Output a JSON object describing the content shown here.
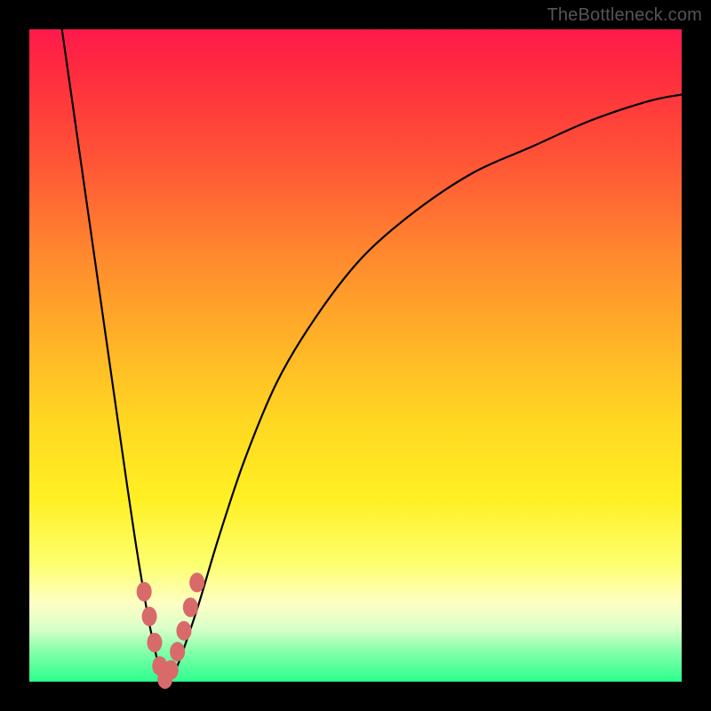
{
  "watermark": "TheBottleneck.com",
  "chart_data": {
    "type": "line",
    "title": "",
    "xlabel": "",
    "ylabel": "",
    "xlim": [
      0,
      100
    ],
    "ylim": [
      0,
      100
    ],
    "grid": false,
    "series": [
      {
        "name": "bottleneck-curve",
        "x": [
          5,
          7,
          9,
          11,
          13,
          15,
          16.5,
          18,
          19,
          20,
          21,
          22.5,
          24,
          26,
          29,
          33,
          38,
          44,
          51,
          59,
          68,
          77,
          86,
          95,
          100
        ],
        "y": [
          100,
          86,
          72,
          58,
          44,
          30,
          20,
          11,
          6,
          2,
          0,
          2,
          6,
          12,
          22,
          34,
          46,
          56,
          65,
          72,
          78,
          82,
          86,
          89,
          90
        ]
      }
    ],
    "markers": {
      "name": "highlight-dots",
      "color": "#d86a6a",
      "x": [
        17.6,
        18.4,
        19.2,
        20.0,
        20.8,
        21.7,
        22.7,
        23.7,
        24.7,
        25.7
      ],
      "y": [
        13.8,
        10.0,
        6.0,
        2.4,
        0.4,
        1.8,
        4.6,
        7.8,
        11.4,
        15.2
      ]
    }
  }
}
